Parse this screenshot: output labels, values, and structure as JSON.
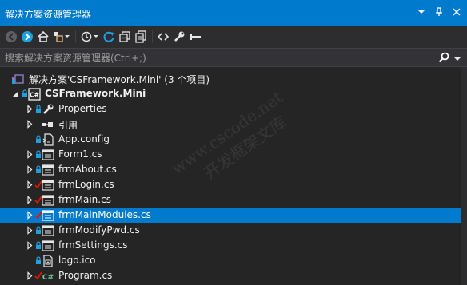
{
  "panel": {
    "title": "解决方案资源管理器",
    "controls": [
      {
        "name": "dropdown-icon"
      },
      {
        "name": "pin-icon"
      },
      {
        "name": "close-icon"
      }
    ]
  },
  "search": {
    "placeholder": "搜索解决方案资源管理器(Ctrl+;)"
  },
  "toolbar": {
    "buttons": [
      "back-icon",
      "forward-icon",
      "home-icon",
      "switch-views-icon",
      "history-icon",
      "refresh-icon",
      "collapse-all-icon",
      "show-all-files-icon",
      "code-view-icon",
      "properties-icon",
      "preview-icon"
    ]
  },
  "tree": {
    "solution": "解决方案'CSFramework.Mini' (3 个项目)",
    "project": "CSFramework.Mini",
    "items": [
      {
        "label": "Properties",
        "icon": "wrench-icon"
      },
      {
        "label": "引用",
        "icon": "references-icon"
      },
      {
        "label": "App.config",
        "icon": "config-icon"
      },
      {
        "label": "Form1.cs",
        "icon": "form-icon"
      },
      {
        "label": "frmAbout.cs",
        "icon": "form-icon"
      },
      {
        "label": "frmLogin.cs",
        "icon": "form-icon"
      },
      {
        "label": "frmMain.cs",
        "icon": "form-icon"
      },
      {
        "label": "frmMainModules.cs",
        "icon": "form-icon"
      },
      {
        "label": "frmModifyPwd.cs",
        "icon": "form-icon"
      },
      {
        "label": "frmSettings.cs",
        "icon": "form-icon"
      },
      {
        "label": "logo.ico",
        "icon": "image-icon"
      },
      {
        "label": "Program.cs",
        "icon": "csharp-file-icon"
      }
    ]
  },
  "watermark": {
    "line1": "www.cscode.net",
    "line2": "开发框架文库"
  },
  "colors": {
    "accent": "#007acc",
    "background": "#252526",
    "lock": "#1ba1e2",
    "checkmark": "#e51400"
  }
}
